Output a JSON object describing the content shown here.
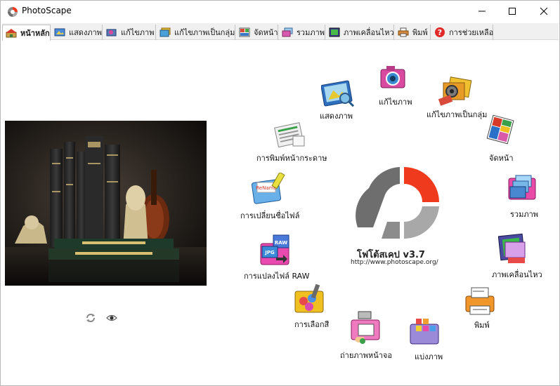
{
  "window": {
    "title": "PhotoScape"
  },
  "tabs": [
    {
      "label": "หน้าหลัก",
      "active": true,
      "icon": "home-icon"
    },
    {
      "label": "แสดงภาพ",
      "active": false,
      "icon": "viewer-icon"
    },
    {
      "label": "แก้ไขภาพ",
      "active": false,
      "icon": "editor-icon"
    },
    {
      "label": "แก้ไขภาพเป็นกลุ่ม",
      "active": false,
      "icon": "batch-editor-icon"
    },
    {
      "label": "จัดหน้า",
      "active": false,
      "icon": "page-icon"
    },
    {
      "label": "รวมภาพ",
      "active": false,
      "icon": "combine-icon"
    },
    {
      "label": "ภาพเคลื่อนไหว",
      "active": false,
      "icon": "animated-gif-icon"
    },
    {
      "label": "พิมพ์",
      "active": false,
      "icon": "print-icon"
    },
    {
      "label": "การช่วยเหลือ",
      "active": false,
      "icon": "help-icon"
    }
  ],
  "menu": {
    "viewer": "แสดงภาพ",
    "editor": "แก้ไขภาพ",
    "batch_editor": "แก้ไขภาพเป็นกลุ่ม",
    "page": "จัดหน้า",
    "combine": "รวมภาพ",
    "animated_gif": "ภาพเคลื่อนไหว",
    "print": "พิมพ์",
    "splitter": "แบ่งภาพ",
    "screen_capture": "ถ่ายภาพหน้าจอ",
    "color_picker": "การเลือกสี",
    "raw_converter": "การแปลงไฟล์ RAW",
    "rename": "การเปลี่ยนชื่อไฟล์",
    "paper_print": "การพิมพ์หน้ากระดาษ"
  },
  "about": {
    "version": "โฟโต้สเคป v3.7",
    "url": "http://www.photoscape.org/"
  },
  "colors": {
    "logo_red": "#f03a1e",
    "logo_gray": "#a8a8a8",
    "logo_dark": "#6e6e6e"
  }
}
